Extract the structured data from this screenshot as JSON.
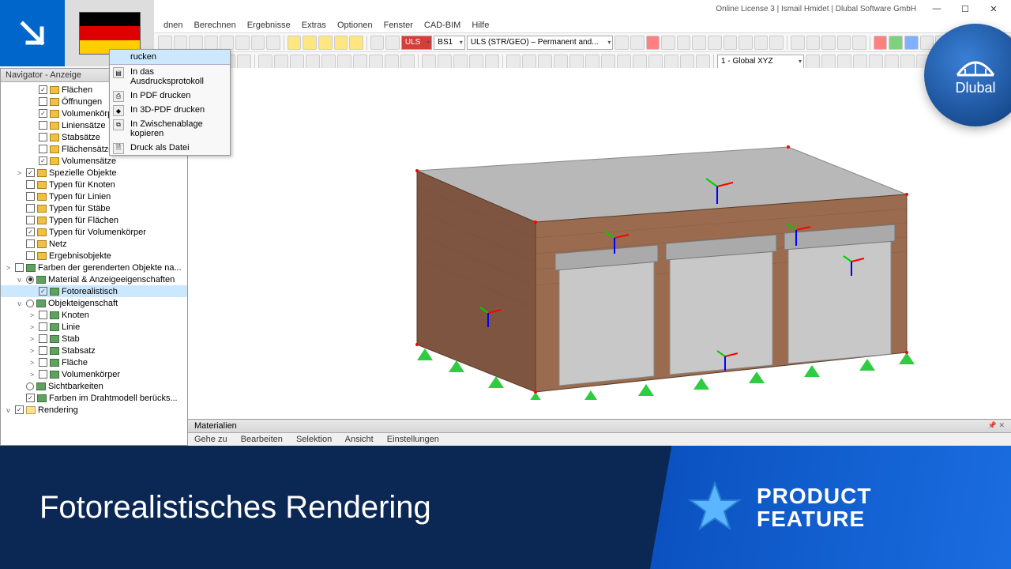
{
  "window": {
    "license": "Online License 3 | Ismail Hmidet | Dlubal Software GmbH",
    "min": "—",
    "max": "☐",
    "close": "✕"
  },
  "menu": {
    "items": [
      "dnen",
      "Berechnen",
      "Ergebnisse",
      "Extras",
      "Optionen",
      "Fenster",
      "CAD-BIM",
      "Hilfe"
    ]
  },
  "toolbar1": {
    "lc_tag": "ULS",
    "lc_code": "BS1",
    "lc_desc": "ULS (STR/GEO) – Permanent and..."
  },
  "toolbar2": {
    "coord": "1 - Global XYZ"
  },
  "ctx": {
    "header": "rucken",
    "items": [
      "In das Ausdrucksprotokoll",
      "In PDF drucken",
      "In 3D-PDF drucken",
      "In Zwischenablage kopieren",
      "Druck als Datei"
    ]
  },
  "nav": {
    "title": "Navigator - Anzeige",
    "rows": [
      {
        "i": 2,
        "cb": true,
        "ck": true,
        "ic": "tag",
        "t": "Flächen"
      },
      {
        "i": 2,
        "cb": true,
        "ck": false,
        "ic": "tag",
        "t": "Öffnungen"
      },
      {
        "i": 2,
        "cb": true,
        "ck": true,
        "ic": "tag",
        "t": "Volumenkörp"
      },
      {
        "i": 2,
        "cb": true,
        "ck": false,
        "ic": "tag",
        "t": "Liniensätze"
      },
      {
        "i": 2,
        "cb": true,
        "ck": false,
        "ic": "tag",
        "t": "Stabsätze"
      },
      {
        "i": 2,
        "cb": true,
        "ck": false,
        "ic": "tag",
        "t": "Flächensätze"
      },
      {
        "i": 2,
        "cb": true,
        "ck": true,
        "ic": "tag",
        "t": "Volumensätze"
      },
      {
        "i": 1,
        "exp": ">",
        "cb": true,
        "ck": true,
        "ic": "tag",
        "t": "Spezielle Objekte"
      },
      {
        "i": 1,
        "cb": true,
        "ck": false,
        "ic": "tag",
        "t": "Typen für Knoten"
      },
      {
        "i": 1,
        "cb": true,
        "ck": false,
        "ic": "tag",
        "t": "Typen für Linien"
      },
      {
        "i": 1,
        "cb": true,
        "ck": false,
        "ic": "tag",
        "t": "Typen für Stäbe"
      },
      {
        "i": 1,
        "cb": true,
        "ck": false,
        "ic": "tag",
        "t": "Typen für Flächen"
      },
      {
        "i": 1,
        "cb": true,
        "ck": true,
        "ic": "tag",
        "t": "Typen für Volumenkörper"
      },
      {
        "i": 1,
        "cb": true,
        "ck": false,
        "ic": "tag",
        "t": "Netz"
      },
      {
        "i": 1,
        "cb": true,
        "ck": false,
        "ic": "tag",
        "t": "Ergebnisobjekte"
      },
      {
        "i": 0,
        "exp": ">",
        "cb": true,
        "ck": false,
        "ic": "cube",
        "t": "Farben der gerenderten Objekte na..."
      },
      {
        "i": 1,
        "exp": "v",
        "rb": true,
        "ck": true,
        "ic": "cube",
        "t": "Material & Anzeigeeigenschaften"
      },
      {
        "i": 2,
        "cb": true,
        "ck": true,
        "ic": "cube",
        "t": "Fotorealistisch",
        "sel": true
      },
      {
        "i": 1,
        "exp": "v",
        "rb": true,
        "ck": false,
        "ic": "cube",
        "t": "Objekteigenschaft"
      },
      {
        "i": 2,
        "exp": ">",
        "cb": true,
        "ck": false,
        "ic": "cube",
        "t": "Knoten"
      },
      {
        "i": 2,
        "exp": ">",
        "cb": true,
        "ck": false,
        "ic": "cube",
        "t": "Linie"
      },
      {
        "i": 2,
        "exp": ">",
        "cb": true,
        "ck": false,
        "ic": "cube",
        "t": "Stab"
      },
      {
        "i": 2,
        "exp": ">",
        "cb": true,
        "ck": false,
        "ic": "cube",
        "t": "Stabsatz"
      },
      {
        "i": 2,
        "exp": ">",
        "cb": true,
        "ck": false,
        "ic": "cube",
        "t": "Fläche"
      },
      {
        "i": 2,
        "exp": ">",
        "cb": true,
        "ck": false,
        "ic": "cube",
        "t": "Volumenkörper"
      },
      {
        "i": 1,
        "rb": true,
        "ck": false,
        "ic": "cube",
        "t": "Sichtbarkeiten"
      },
      {
        "i": 1,
        "cb": true,
        "ck": true,
        "ic": "cube",
        "t": "Farben im Drahtmodell berücks..."
      },
      {
        "i": 0,
        "exp": "v",
        "cb": true,
        "ck": true,
        "ic": "folder",
        "t": "Rendering"
      }
    ]
  },
  "materials": {
    "title": "Materialien",
    "menu": [
      "Gehe zu",
      "Bearbeiten",
      "Selektion",
      "Ansicht",
      "Einstellungen"
    ]
  },
  "badge": {
    "text": "Dlubal"
  },
  "banner": {
    "title": "Fotorealistisches Rendering",
    "pf1": "PRODUCT",
    "pf2": "FEATURE"
  }
}
